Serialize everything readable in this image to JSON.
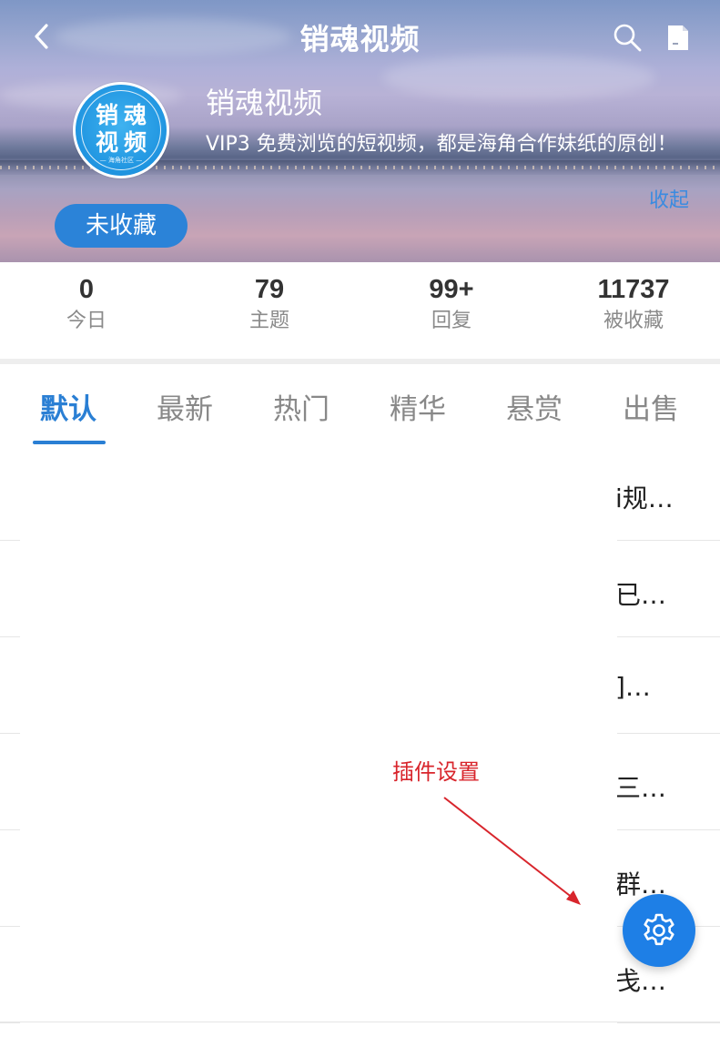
{
  "header": {
    "title": "销魂视频",
    "forum_name": "销魂视频",
    "description": " VIP3 免费浏览的短视频，都是海角合作妹纸的原创！",
    "collapse_label": "收起",
    "favorite_label": "未收藏",
    "logo_line1": "销魂",
    "logo_line2": "视频",
    "logo_line3": "— 海角社区 —"
  },
  "stats": [
    {
      "value": "0",
      "label": "今日"
    },
    {
      "value": "79",
      "label": "主题"
    },
    {
      "value": "99+",
      "label": "回复"
    },
    {
      "value": "11737",
      "label": "被收藏"
    }
  ],
  "tabs": [
    {
      "label": "默认",
      "active": true
    },
    {
      "label": "最新"
    },
    {
      "label": "热门"
    },
    {
      "label": "精华"
    },
    {
      "label": "悬赏"
    },
    {
      "label": "出售"
    }
  ],
  "threads": [
    {
      "title": "i规…"
    },
    {
      "title": "已…"
    },
    {
      "title": "]…"
    },
    {
      "title": "三…"
    },
    {
      "title": "群…"
    },
    {
      "title": "戋…"
    }
  ],
  "annotation": {
    "label": "插件设置"
  },
  "icons": {
    "back": "chevron-left-icon",
    "search": "search-icon",
    "note": "note-icon",
    "settings": "gear-icon"
  },
  "colors": {
    "accent": "#2a7fd4",
    "fab": "#1e7fe6",
    "annotation": "#d8252c"
  }
}
